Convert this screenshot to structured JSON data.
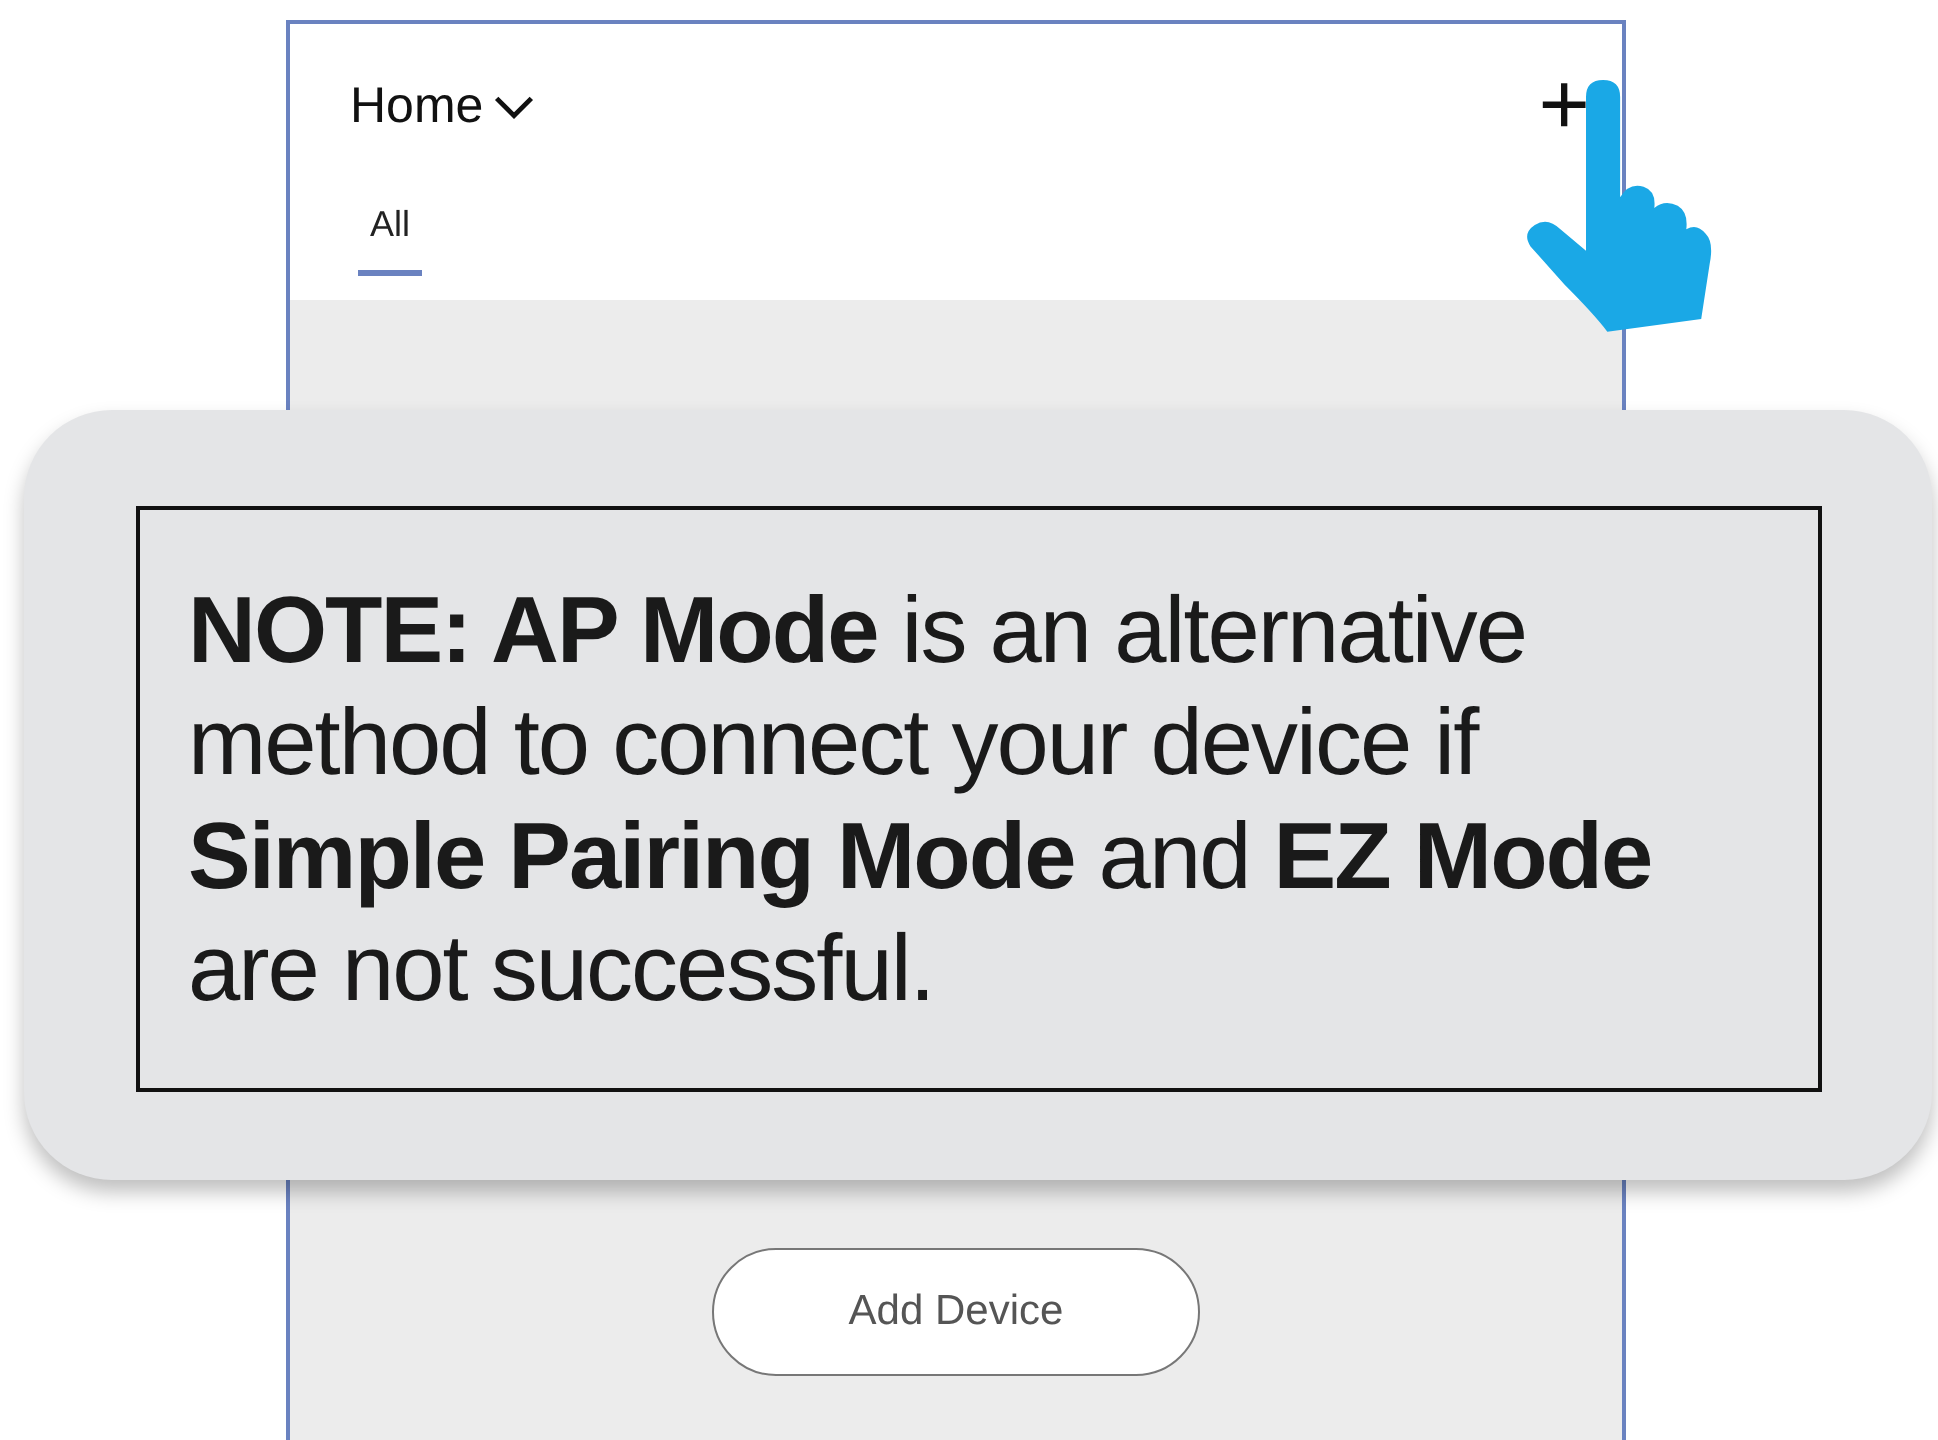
{
  "header": {
    "title": "Home",
    "add_symbol": "+"
  },
  "tabs": [
    {
      "label": "All",
      "selected": true
    }
  ],
  "note": {
    "text": "**NOTE: AP Mode** is an alternative method to connect your device if **Simple Pairing Mode** and **EZ Mode** are not successful."
  },
  "add_device_button": {
    "label": "Add Device"
  }
}
